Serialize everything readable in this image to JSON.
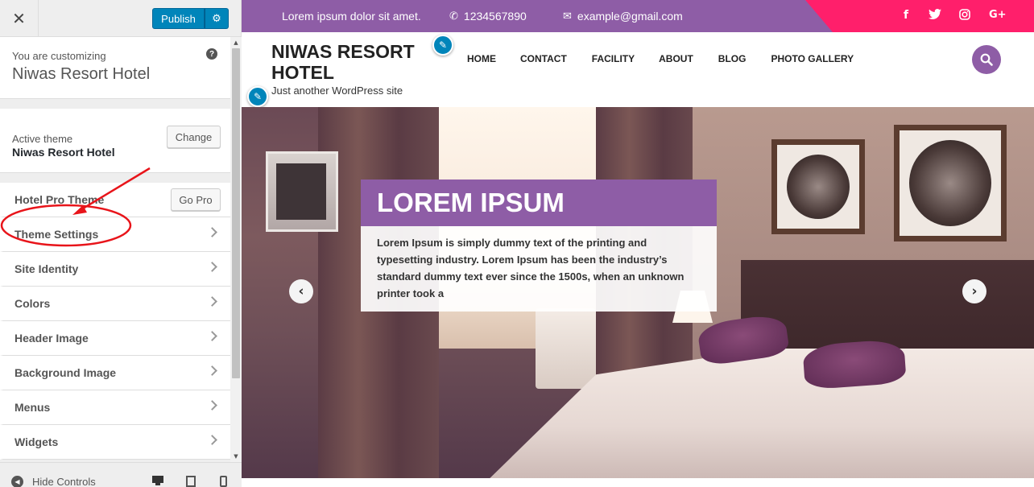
{
  "customizer": {
    "close_icon": "close-icon",
    "publish_label": "Publish",
    "gear_icon": "gear-icon",
    "customizing_label": "You are customizing",
    "site_name": "Niwas Resort Hotel",
    "active_theme_label": "Active theme",
    "active_theme_name": "Niwas Resort Hotel",
    "change_label": "Change",
    "sections": [
      {
        "label": "Hotel Pro Theme",
        "button": "Go Pro"
      },
      {
        "label": "Theme Settings"
      },
      {
        "label": "Site Identity"
      },
      {
        "label": "Colors"
      },
      {
        "label": "Header Image"
      },
      {
        "label": "Background Image"
      },
      {
        "label": "Menus"
      },
      {
        "label": "Widgets"
      }
    ],
    "hide_controls_label": "Hide Controls",
    "accent_color": "#0085ba"
  },
  "preview": {
    "topbar": {
      "text": "Lorem ipsum dolor sit amet.",
      "phone": "1234567890",
      "email": "example@gmail.com",
      "purple": "#8e5da6",
      "pink": "#ff1f6b",
      "social_icons": [
        "facebook-icon",
        "twitter-icon",
        "instagram-icon",
        "google-plus-icon"
      ]
    },
    "site_title": "NIWAS RESORT HOTEL",
    "tagline": "Just another WordPress site",
    "nav": [
      "HOME",
      "CONTACT",
      "FACILITY",
      "ABOUT",
      "BLOG",
      "PHOTO GALLERY"
    ],
    "slide": {
      "title": "LOREM IPSUM",
      "text": "Lorem Ipsum is simply dummy text of the printing and typesetting industry. Lorem Ipsum has been the industry’s standard dummy text ever since the 1500s, when an unknown printer took a"
    }
  }
}
